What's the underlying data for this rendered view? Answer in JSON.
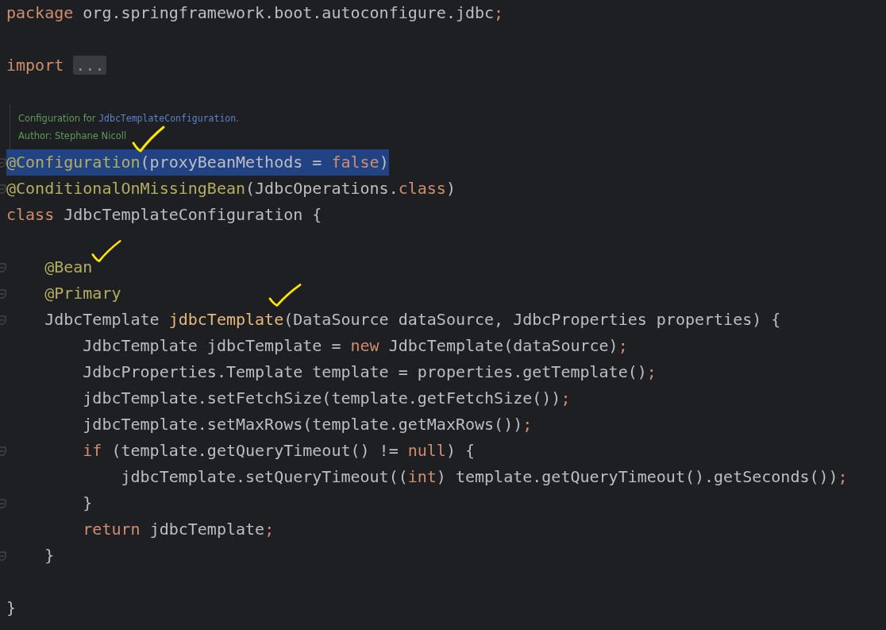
{
  "editor": {
    "lines": [
      {
        "kind": "code",
        "highlighted": false,
        "tokens": [
          {
            "kind": "keyword",
            "text": "package "
          },
          {
            "kind": "plain",
            "text": "org.springframework.boot.autoconfigure.jdbc"
          },
          {
            "kind": "keyword",
            "text": ";"
          }
        ]
      },
      {
        "kind": "blank"
      },
      {
        "kind": "code",
        "highlighted": false,
        "tokens": [
          {
            "kind": "keyword",
            "text": "import "
          },
          {
            "kind": "folded",
            "text": "..."
          }
        ]
      },
      {
        "kind": "blank"
      },
      {
        "kind": "doc",
        "paragraphs": [
          [
            {
              "kind": "text",
              "text": "Configuration for "
            },
            {
              "kind": "link",
              "text": "JdbcTemplateConfiguration"
            },
            {
              "kind": "text",
              "text": "."
            }
          ],
          [
            {
              "kind": "text",
              "text": "Author: Stephane Nicoll"
            }
          ]
        ]
      },
      {
        "kind": "code",
        "highlighted": true,
        "fold": true,
        "tokens": [
          {
            "kind": "annotation",
            "text": "@Configuration"
          },
          {
            "kind": "plain",
            "text": "(proxyBeanMethods = "
          },
          {
            "kind": "keyword",
            "text": "false"
          },
          {
            "kind": "plain",
            "text": ")"
          }
        ]
      },
      {
        "kind": "code",
        "highlighted": false,
        "fold": true,
        "tokens": [
          {
            "kind": "annotation",
            "text": "@ConditionalOnMissingBean"
          },
          {
            "kind": "plain",
            "text": "(JdbcOperations."
          },
          {
            "kind": "keyword",
            "text": "class"
          },
          {
            "kind": "plain",
            "text": ")"
          }
        ]
      },
      {
        "kind": "code",
        "highlighted": false,
        "tokens": [
          {
            "kind": "keyword",
            "text": "class "
          },
          {
            "kind": "plain",
            "text": "JdbcTemplateConfiguration {"
          }
        ]
      },
      {
        "kind": "blank"
      },
      {
        "kind": "code",
        "highlighted": false,
        "fold": true,
        "tokens": [
          {
            "kind": "annotation",
            "text": "    @Bean"
          }
        ]
      },
      {
        "kind": "code",
        "highlighted": false,
        "fold": true,
        "tokens": [
          {
            "kind": "annotation",
            "text": "    @Primary"
          }
        ]
      },
      {
        "kind": "code",
        "highlighted": false,
        "fold": true,
        "tokens": [
          {
            "kind": "plain",
            "text": "    JdbcTemplate "
          },
          {
            "kind": "method",
            "text": "jdbcTemplate"
          },
          {
            "kind": "plain",
            "text": "(DataSource dataSource, JdbcProperties properties) {"
          }
        ]
      },
      {
        "kind": "code",
        "highlighted": false,
        "tokens": [
          {
            "kind": "plain",
            "text": "        JdbcTemplate jdbcTemplate = "
          },
          {
            "kind": "keyword",
            "text": "new "
          },
          {
            "kind": "plain",
            "text": "JdbcTemplate(dataSource)"
          },
          {
            "kind": "keyword",
            "text": ";"
          }
        ]
      },
      {
        "kind": "code",
        "highlighted": false,
        "tokens": [
          {
            "kind": "plain",
            "text": "        JdbcProperties.Template template = properties.getTemplate()"
          },
          {
            "kind": "keyword",
            "text": ";"
          }
        ]
      },
      {
        "kind": "code",
        "highlighted": false,
        "tokens": [
          {
            "kind": "plain",
            "text": "        jdbcTemplate.setFetchSize(template.getFetchSize())"
          },
          {
            "kind": "keyword",
            "text": ";"
          }
        ]
      },
      {
        "kind": "code",
        "highlighted": false,
        "tokens": [
          {
            "kind": "plain",
            "text": "        jdbcTemplate.setMaxRows(template.getMaxRows())"
          },
          {
            "kind": "keyword",
            "text": ";"
          }
        ]
      },
      {
        "kind": "code",
        "highlighted": false,
        "fold": true,
        "tokens": [
          {
            "kind": "keyword",
            "text": "        if "
          },
          {
            "kind": "plain",
            "text": "(template.getQueryTimeout() != "
          },
          {
            "kind": "keyword",
            "text": "null"
          },
          {
            "kind": "plain",
            "text": ") {"
          }
        ]
      },
      {
        "kind": "code",
        "highlighted": false,
        "tokens": [
          {
            "kind": "plain",
            "text": "            jdbcTemplate.setQueryTimeout(("
          },
          {
            "kind": "keyword",
            "text": "int"
          },
          {
            "kind": "plain",
            "text": ") template.getQueryTimeout().getSeconds())"
          },
          {
            "kind": "keyword",
            "text": ";"
          }
        ]
      },
      {
        "kind": "code",
        "highlighted": false,
        "fold": true,
        "tokens": [
          {
            "kind": "plain",
            "text": "        }"
          }
        ]
      },
      {
        "kind": "code",
        "highlighted": false,
        "tokens": [
          {
            "kind": "keyword",
            "text": "        return "
          },
          {
            "kind": "plain",
            "text": "jdbcTemplate"
          },
          {
            "kind": "keyword",
            "text": ";"
          }
        ]
      },
      {
        "kind": "code",
        "highlighted": false,
        "fold": true,
        "tokens": [
          {
            "kind": "plain",
            "text": "    }"
          }
        ]
      },
      {
        "kind": "blank"
      },
      {
        "kind": "code",
        "highlighted": false,
        "tokens": [
          {
            "kind": "plain",
            "text": "}"
          }
        ]
      }
    ]
  }
}
